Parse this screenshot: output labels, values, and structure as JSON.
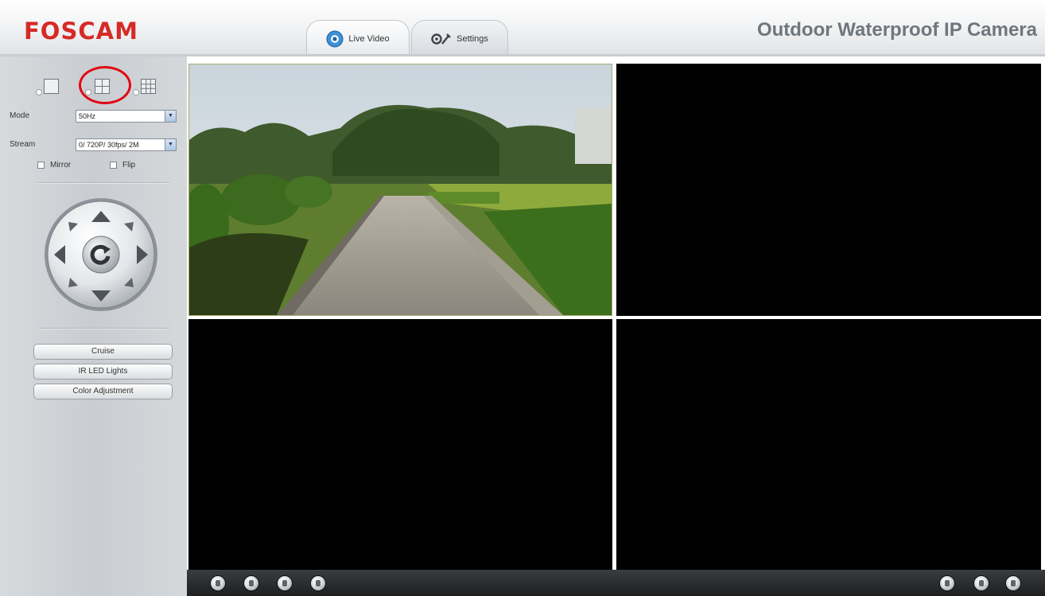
{
  "header": {
    "logo_text": "FOSCAM",
    "product_title": "Outdoor Waterproof IP Camera",
    "tabs": [
      {
        "label": "Live Video",
        "icon": "webcam-icon",
        "active": true
      },
      {
        "label": "Settings",
        "icon": "wrench-gear-icon",
        "active": false
      }
    ]
  },
  "sidebar": {
    "layout_options": [
      {
        "icon": "single-view-icon",
        "selected": false
      },
      {
        "icon": "quad-view-icon",
        "selected": true,
        "highlighted": true
      },
      {
        "icon": "nine-view-icon",
        "selected": false
      }
    ],
    "mode": {
      "label": "Mode",
      "value": "50Hz"
    },
    "stream": {
      "label": "Stream",
      "value": "0/ 720P/ 30fps/ 2M"
    },
    "mirror": {
      "label": "Mirror",
      "checked": false
    },
    "flip": {
      "label": "Flip",
      "checked": false
    },
    "ptz": {
      "controls": [
        "up",
        "down",
        "left",
        "right",
        "up-left",
        "up-right",
        "down-left",
        "down-right",
        "home"
      ]
    },
    "buttons": {
      "cruise": "Cruise",
      "ir_led": "IR LED Lights",
      "color_adjust": "Color Adjustment"
    }
  },
  "video": {
    "panes": [
      {
        "name": "channel-1",
        "has_feed": true
      },
      {
        "name": "channel-2",
        "has_feed": false
      },
      {
        "name": "channel-3",
        "has_feed": false
      },
      {
        "name": "channel-4",
        "has_feed": false
      }
    ]
  },
  "bottom_bar": {
    "left_controls": [
      "play-icon",
      "stop-icon",
      "talk-icon",
      "audio-icon"
    ],
    "right_controls": [
      "snapshot-icon",
      "record-icon",
      "fullscreen-icon"
    ]
  },
  "colors": {
    "brand_red": "#d62a26",
    "highlight_circle": "#e30613",
    "video_background": "#000000"
  }
}
